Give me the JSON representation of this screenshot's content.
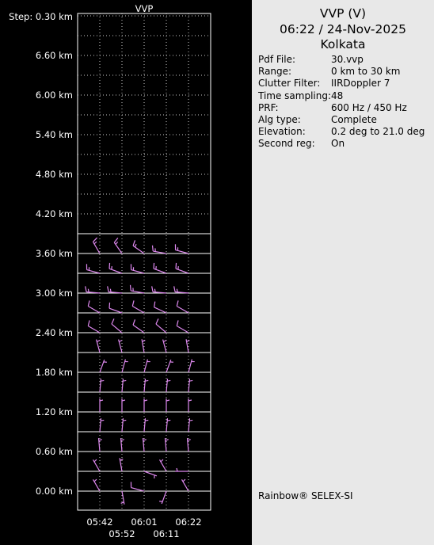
{
  "right_panel": {
    "title": "VVP (V)",
    "datetime": "06:22 / 24-Nov-2025",
    "station": "Kolkata",
    "info": [
      {
        "label": "Pdf File:",
        "value": "30.vvp"
      },
      {
        "label": "Range:",
        "value": "0 km to 30 km"
      },
      {
        "label": "Clutter Filter:",
        "value": "IIRDoppler 7"
      },
      {
        "label": "Time sampling:",
        "value": "48"
      },
      {
        "label": "PRF:",
        "value": "600 Hz / 450 Hz"
      },
      {
        "label": "Alg type:",
        "value": "Complete"
      },
      {
        "label": "Elevation:",
        "value": "0.2 deg to 21.0 deg"
      },
      {
        "label": "Second reg:",
        "value": "On"
      }
    ],
    "brand": "Rainbow® SELEX-SI"
  },
  "chart_data": {
    "type": "wind-barb",
    "title": "VVP",
    "step_label": "Step: 0.30 km",
    "y_unit": "km",
    "y_ticks": [
      "0.00 km",
      "0.60 km",
      "1.20 km",
      "1.80 km",
      "2.40 km",
      "3.00 km",
      "3.60 km",
      "4.20 km",
      "4.80 km",
      "5.40 km",
      "6.00 km",
      "6.60 km"
    ],
    "ylim": [
      0,
      7.2
    ],
    "x_ticks_upper": [
      "05:42",
      "06:01",
      "06:22"
    ],
    "x_ticks_lower": [
      "05:52",
      "06:11"
    ],
    "times": [
      "05:42",
      "05:52",
      "06:01",
      "06:11",
      "06:22"
    ],
    "grid": true,
    "colors": {
      "barb": "#dd88ee",
      "grid": "#ffffff",
      "dotted": "#c8c8c8"
    },
    "barb_rows": [
      {
        "height_km": 0.0,
        "dirs_deg": [
          330,
          170,
          285,
          200,
          330
        ],
        "speeds_kt": [
          5,
          5,
          10,
          5,
          5
        ]
      },
      {
        "height_km": 0.3,
        "dirs_deg": [
          330,
          350,
          110,
          330,
          270
        ],
        "speeds_kt": [
          5,
          5,
          5,
          5,
          5
        ]
      },
      {
        "height_km": 0.6,
        "dirs_deg": [
          355,
          355,
          355,
          355,
          355
        ],
        "speeds_kt": [
          5,
          5,
          5,
          5,
          5
        ]
      },
      {
        "height_km": 0.9,
        "dirs_deg": [
          5,
          5,
          5,
          5,
          5
        ],
        "speeds_kt": [
          5,
          5,
          5,
          5,
          5
        ]
      },
      {
        "height_km": 1.2,
        "dirs_deg": [
          0,
          0,
          0,
          0,
          0
        ],
        "speeds_kt": [
          5,
          5,
          5,
          5,
          5
        ]
      },
      {
        "height_km": 1.5,
        "dirs_deg": [
          5,
          5,
          5,
          5,
          5
        ],
        "speeds_kt": [
          5,
          5,
          5,
          5,
          5
        ]
      },
      {
        "height_km": 1.8,
        "dirs_deg": [
          20,
          15,
          15,
          20,
          15
        ],
        "speeds_kt": [
          5,
          5,
          5,
          5,
          5
        ]
      },
      {
        "height_km": 2.1,
        "dirs_deg": [
          345,
          345,
          350,
          345,
          350
        ],
        "speeds_kt": [
          5,
          5,
          5,
          5,
          5
        ]
      },
      {
        "height_km": 2.4,
        "dirs_deg": [
          300,
          310,
          305,
          310,
          300
        ],
        "speeds_kt": [
          10,
          10,
          10,
          10,
          10
        ]
      },
      {
        "height_km": 2.7,
        "dirs_deg": [
          300,
          290,
          300,
          295,
          300
        ],
        "speeds_kt": [
          10,
          10,
          10,
          10,
          10
        ]
      },
      {
        "height_km": 3.0,
        "dirs_deg": [
          275,
          275,
          280,
          275,
          275
        ],
        "speeds_kt": [
          15,
          15,
          15,
          15,
          15
        ]
      },
      {
        "height_km": 3.3,
        "dirs_deg": [
          285,
          290,
          285,
          290,
          290
        ],
        "speeds_kt": [
          15,
          15,
          15,
          15,
          15
        ]
      },
      {
        "height_km": 3.6,
        "dirs_deg": [
          330,
          325,
          305,
          280,
          285
        ],
        "speeds_kt": [
          15,
          15,
          15,
          15,
          15
        ]
      }
    ]
  }
}
